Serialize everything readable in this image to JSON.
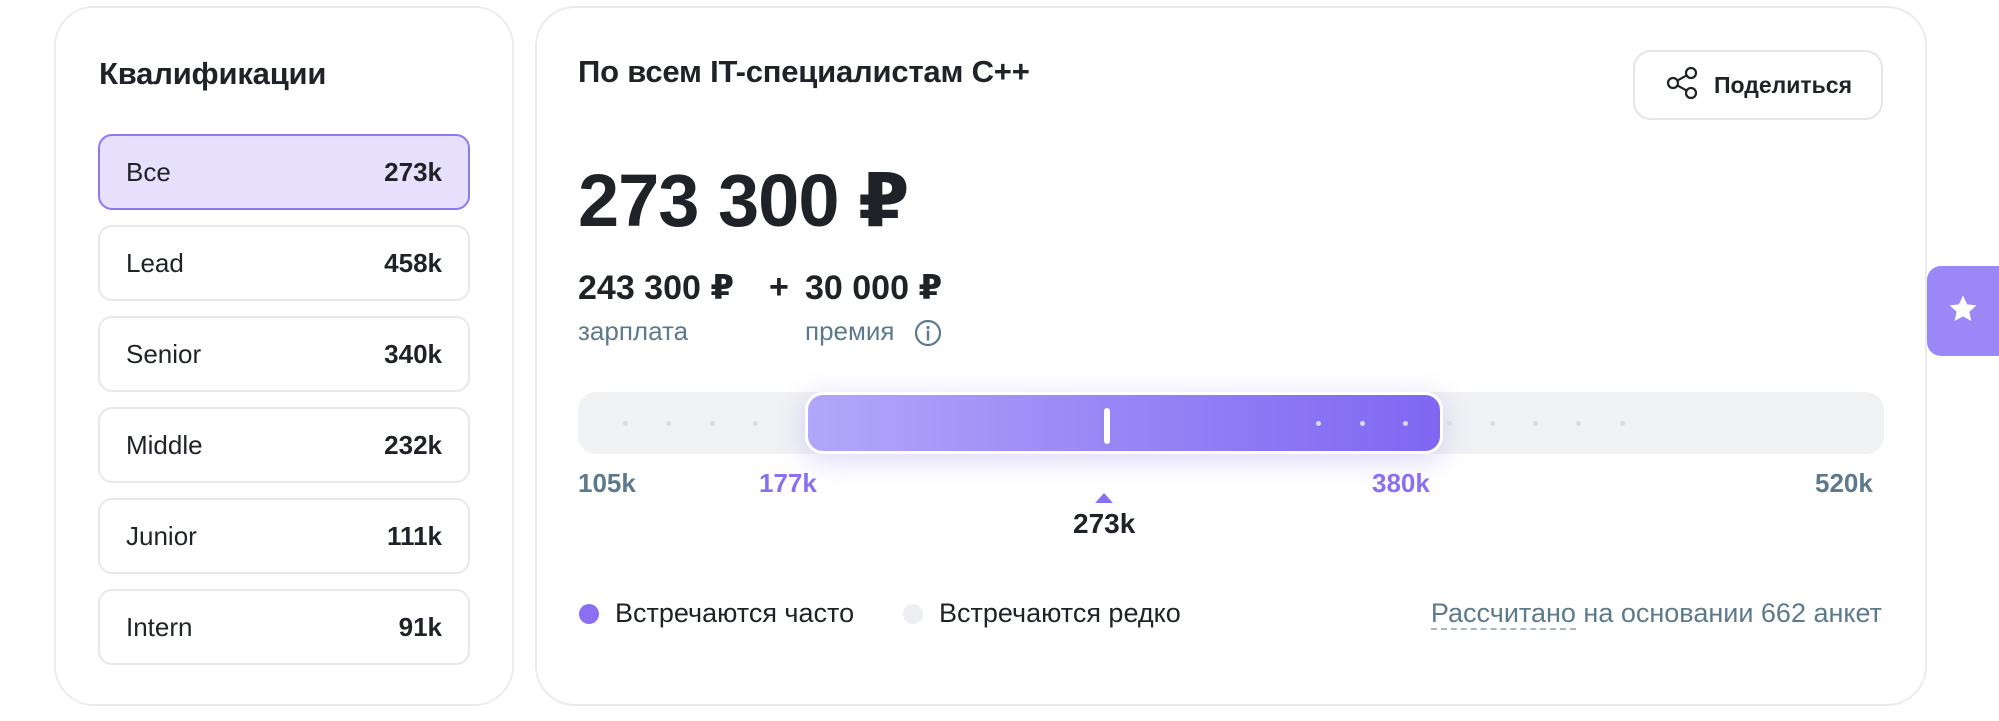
{
  "qualifications": {
    "title": "Квалификации",
    "items": [
      {
        "label": "Все",
        "value": "273k",
        "active": true
      },
      {
        "label": "Lead",
        "value": "458k"
      },
      {
        "label": "Senior",
        "value": "340k"
      },
      {
        "label": "Middle",
        "value": "232k"
      },
      {
        "label": "Junior",
        "value": "111k"
      },
      {
        "label": "Intern",
        "value": "91k"
      }
    ]
  },
  "main": {
    "title": "По всем IT-специалистам C++",
    "share_label": "Поделиться",
    "total": "273 300 ₽",
    "salary": {
      "amount": "243 300 ₽",
      "label": "зарплата"
    },
    "plus": "+",
    "bonus": {
      "amount": "30 000 ₽",
      "label": "премия"
    },
    "range": {
      "min": 105,
      "low": 177,
      "median": 273,
      "high": 380,
      "max": 520,
      "min_label": "105k",
      "low_label": "177k",
      "median_label": "273k",
      "high_label": "380k",
      "max_label": "520k"
    },
    "legend": {
      "often": "Встречаются часто",
      "rare": "Встречаются редко"
    },
    "basis": {
      "link_text": "Рассчитано",
      "rest_text": " на основании 662 анкет"
    }
  },
  "colors": {
    "accent": "#8a6ff3",
    "active_bg": "#e6e0fd",
    "muted_text": "#5c7a8c"
  },
  "icons": {
    "share": "share-icon",
    "info": "info-icon",
    "favorite": "star-icon"
  }
}
